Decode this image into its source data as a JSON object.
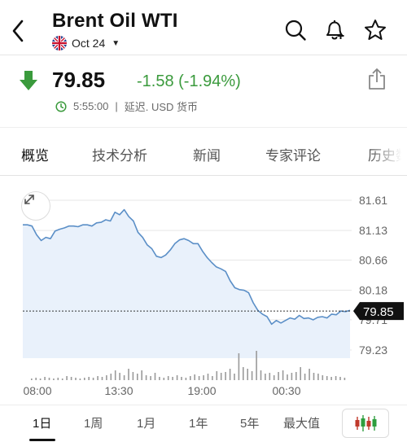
{
  "header": {
    "title": "Brent Oil WTI",
    "contract": "Oct 24",
    "icons": [
      "back-chevron-icon",
      "search-icon",
      "bell-plus-icon",
      "star-icon"
    ]
  },
  "quote": {
    "price": "79.85",
    "change": "-1.58 (-1.94%)",
    "time": "5:55:00",
    "status": "延迟. USD 货币",
    "colors": {
      "down_arrow": "#3a9a3c",
      "change_text": "#3a9a3c"
    }
  },
  "tabs": [
    {
      "label": "概览",
      "active": true
    },
    {
      "label": "技术分析"
    },
    {
      "label": "新闻"
    },
    {
      "label": "专家评论"
    },
    {
      "label": "历史数"
    }
  ],
  "periods": [
    {
      "label": "1日",
      "active": true
    },
    {
      "label": "1周"
    },
    {
      "label": "1月"
    },
    {
      "label": "1年"
    },
    {
      "label": "5年"
    },
    {
      "label": "最大值"
    }
  ],
  "chart_data": {
    "type": "area",
    "y_ticks": [
      "81.61",
      "81.13",
      "80.66",
      "80.18",
      "79.71",
      "79.23"
    ],
    "y_tick_values": [
      81.61,
      81.13,
      80.66,
      80.18,
      79.71,
      79.23
    ],
    "x_ticks": [
      "08:00",
      "13:30",
      "19:00",
      "00:30"
    ],
    "ylim": [
      79.0,
      81.8
    ],
    "grid": true,
    "current_value": 79.85,
    "current_label": "79.85",
    "line_color": "#5b8fc7",
    "fill_color": "#e9f1fb",
    "series": [
      {
        "values": [
          81.22,
          81.22,
          81.2,
          81.06,
          80.97,
          81.02,
          81.0,
          81.12,
          81.15,
          81.17,
          81.2,
          81.2,
          81.19,
          81.22,
          81.22,
          81.2,
          81.25,
          81.26,
          81.3,
          81.28,
          81.42,
          81.38,
          81.46,
          81.35,
          81.28,
          81.1,
          81.02,
          80.9,
          80.84,
          80.72,
          80.7,
          80.74,
          80.82,
          80.92,
          80.98,
          81.0,
          80.97,
          80.92,
          80.92,
          80.8,
          80.7,
          80.62,
          80.55,
          80.52,
          80.48,
          80.33,
          80.22,
          80.19,
          80.18,
          80.14,
          79.98,
          79.86,
          79.8,
          79.76,
          79.64,
          79.7,
          79.66,
          79.7,
          79.74,
          79.72,
          79.78,
          79.73,
          79.74,
          79.71,
          79.75,
          79.76,
          79.74,
          79.8,
          79.79,
          79.85,
          79.84,
          79.86
        ]
      }
    ],
    "volume": [
      2,
      3,
      2,
      4,
      3,
      2,
      3,
      2,
      5,
      4,
      3,
      2,
      3,
      4,
      3,
      5,
      4,
      6,
      8,
      12,
      9,
      6,
      14,
      10,
      8,
      12,
      6,
      5,
      9,
      4,
      3,
      5,
      4,
      6,
      4,
      3,
      5,
      7,
      5,
      6,
      8,
      5,
      11,
      9,
      10,
      14,
      8,
      33,
      16,
      14,
      11,
      36,
      12,
      8,
      9,
      6,
      10,
      12,
      7,
      9,
      10,
      16,
      8,
      14,
      9,
      8,
      6,
      5,
      4,
      5,
      4,
      3
    ]
  }
}
